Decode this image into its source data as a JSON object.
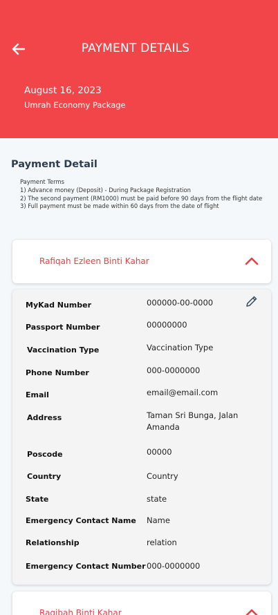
{
  "header": {
    "title": "PAYMENT DETAILS",
    "date": "August 16, 2023",
    "package": "Umrah Economy Package",
    "back_icon": "arrow-left-icon",
    "bg_color": "#f2454a"
  },
  "section": {
    "title": "Payment Detail"
  },
  "terms": {
    "heading": "Payment Terms",
    "items": [
      "1) Advance money (Deposit) - During Package Registration",
      "2) The second payment (RM1000) must be paid before 90 days from the flight date",
      "3) Full payment must be made within 60 days from the date of flight"
    ]
  },
  "pilgrims": [
    {
      "name": "Rafiqah Ezleen Binti Kahar",
      "expanded": true,
      "chevron_icon": "chevron-up-icon",
      "edit_icon": "pencil-icon",
      "fields": [
        {
          "label": "MyKad Number",
          "value": "000000-00-0000"
        },
        {
          "label": "Passport Number",
          "value": "00000000"
        },
        {
          "label": "Vaccination Type",
          "value": "Vaccination Type"
        },
        {
          "label": "Phone Number",
          "value": "000-0000000"
        },
        {
          "label": "Email",
          "value": "email@email.com"
        },
        {
          "label": "Address",
          "value": "Taman Sri Bunga, Jalan Amanda"
        },
        {
          "label": "Poscode",
          "value": "00000"
        },
        {
          "label": "Country",
          "value": "Country"
        },
        {
          "label": "State",
          "value": "state"
        },
        {
          "label": "Emergency Contact Name",
          "value": "Name"
        },
        {
          "label": "Relationship",
          "value": "relation"
        },
        {
          "label": "Emergency Contact Number",
          "value": "000-0000000"
        }
      ]
    },
    {
      "name": "Raqibah Binti Kahar",
      "expanded": false,
      "chevron_icon": "chevron-up-icon"
    }
  ],
  "colors": {
    "accent": "#f2454a",
    "name_text": "#e64045",
    "section_title": "#2e3d4f"
  }
}
